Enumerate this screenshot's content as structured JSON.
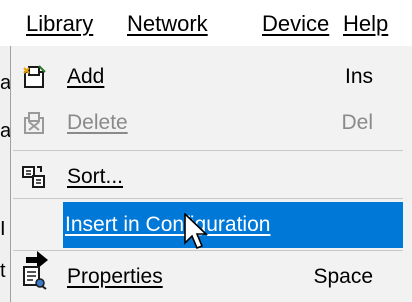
{
  "menubar": {
    "items": [
      "Library",
      "Network",
      "Device",
      "Help"
    ]
  },
  "menu": {
    "items": [
      {
        "label": "Add",
        "shortcut": "Ins",
        "icon": "add-icon",
        "enabled": true
      },
      {
        "label": "Delete",
        "shortcut": "Del",
        "icon": "delete-icon",
        "enabled": false
      },
      {
        "label": "Sort...",
        "shortcut": "",
        "icon": "sort-icon",
        "enabled": true
      },
      {
        "label": "Insert in Configuration",
        "shortcut": "",
        "icon": "arrow-right-icon",
        "enabled": true,
        "highlighted": true
      },
      {
        "label": "Properties",
        "shortcut": "Space",
        "icon": "properties-icon",
        "enabled": true
      }
    ]
  },
  "colors": {
    "highlight": "#0078d7",
    "menu_background": "#f2f2f2",
    "disabled_text": "#8a8a8a"
  },
  "background": {
    "glyphs": [
      "a",
      "a",
      "I",
      "t"
    ]
  }
}
